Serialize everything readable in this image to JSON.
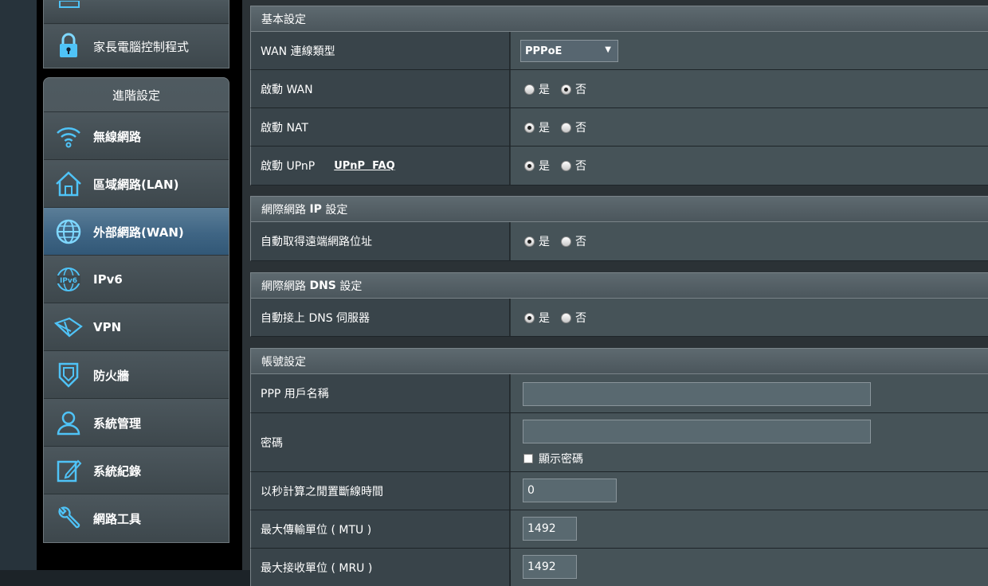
{
  "sidebar": {
    "top_item_label": "家長電腦控制程式",
    "advanced_header": "進階設定",
    "items": [
      {
        "label": "無線網路",
        "icon": "wifi-icon"
      },
      {
        "label": "區域網路(LAN)",
        "icon": "home-icon"
      },
      {
        "label": "外部網路(WAN)",
        "icon": "globe-icon"
      },
      {
        "label": "IPv6",
        "icon": "ipv6-icon"
      },
      {
        "label": "VPN",
        "icon": "vpn-icon"
      },
      {
        "label": "防火牆",
        "icon": "shield-icon"
      },
      {
        "label": "系統管理",
        "icon": "user-icon"
      },
      {
        "label": "系統紀錄",
        "icon": "log-icon"
      },
      {
        "label": "網路工具",
        "icon": "wrench-icon"
      }
    ],
    "active_item": "外部網路(WAN)"
  },
  "basic": {
    "title": "基本設定",
    "wan_type_label": "WAN 連線類型",
    "wan_type_value": "PPPoE",
    "enable_wan_label": "啟動 WAN",
    "enable_nat_label": "啟動 NAT",
    "enable_upnp_label": "啟動 UPnP",
    "upnp_faq": "UPnP  FAQ"
  },
  "radio": {
    "yes": "是",
    "no": "否"
  },
  "wan_ip": {
    "title_pre": "網際網路 ",
    "title_bold": "IP",
    "title_post": " 設定",
    "auto_ip_label": "自動取得遠端網路位址"
  },
  "wan_dns": {
    "title_pre": "網際網路 ",
    "title_bold": "DNS",
    "title_post": " 設定",
    "auto_dns_label": "自動接上 DNS 伺服器"
  },
  "account": {
    "title": "帳號設定",
    "username_label": "PPP 用戶名稱",
    "username_value": "",
    "password_label": "密碼",
    "password_value": "",
    "show_password_label": "顯示密碼",
    "idle_label": "以秒計算之閒置斷線時間",
    "idle_value": "0",
    "mtu_label": "最大傳輸單位 ( MTU )",
    "mtu_value": "1492",
    "mru_label": "最大接收單位 ( MRU )",
    "mru_value": "1492"
  },
  "colors": {
    "active_item": "#3f6584",
    "section_header": "#56636a",
    "icon_glow": "#4fc3f7"
  }
}
